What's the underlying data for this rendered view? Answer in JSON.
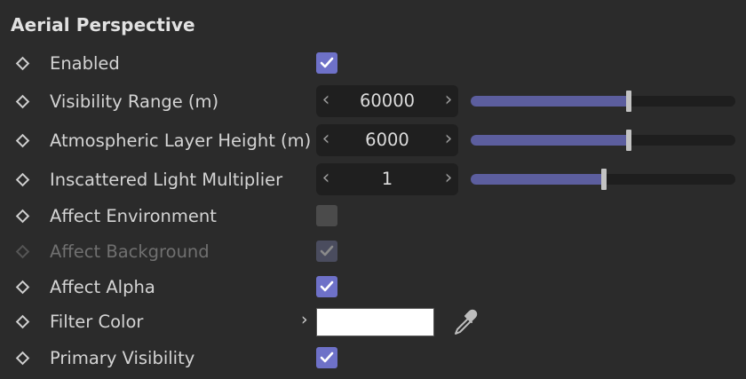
{
  "section": {
    "title": "Aerial Perspective"
  },
  "colors": {
    "accent": "#6e71c8",
    "slider_fill": "#5c5e9e",
    "filter_color": "#ffffff"
  },
  "rows": {
    "enabled": {
      "label": "Enabled",
      "checked": true
    },
    "visibility_range": {
      "label": "Visibility Range (m)",
      "value": "60000",
      "slider_fraction": 0.6
    },
    "layer_height": {
      "label": "Atmospheric Layer Height (m)",
      "value": "6000",
      "slider_fraction": 0.6
    },
    "light_multiplier": {
      "label": "Inscattered Light Multiplier",
      "value": "1",
      "slider_fraction": 0.5
    },
    "affect_environment": {
      "label": "Affect Environment",
      "checked": false
    },
    "affect_background": {
      "label": "Affect Background",
      "checked": true,
      "disabled": true
    },
    "affect_alpha": {
      "label": "Affect Alpha",
      "checked": true
    },
    "filter_color": {
      "label": "Filter Color",
      "icon": "eyedropper-icon"
    },
    "primary_visibility": {
      "label": "Primary Visibility",
      "checked": true
    }
  }
}
